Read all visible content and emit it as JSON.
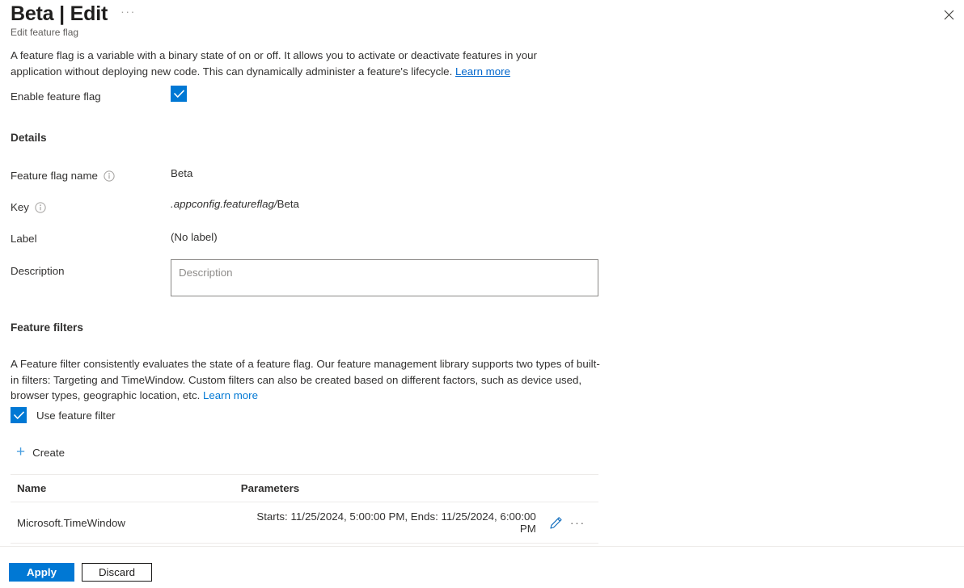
{
  "header": {
    "title": "Beta | Edit",
    "ellipsis": "···",
    "subtitle": "Edit feature flag",
    "close_icon": "close-icon"
  },
  "intro": {
    "text": "A feature flag is a variable with a binary state of on or off. It allows you to activate or deactivate features in your application without deploying new code. This can dynamically administer a feature's lifecycle. ",
    "link_label": "Learn more"
  },
  "enable": {
    "label": "Enable feature flag",
    "checked": true
  },
  "details": {
    "heading": "Details",
    "fields": [
      {
        "label": "Feature flag name",
        "has_info": true,
        "value": "Beta"
      },
      {
        "label": "Key",
        "has_info": true,
        "value_prefix": ".appconfig.featureflag/",
        "value_suffix": "Beta"
      },
      {
        "label": "Label",
        "has_info": false,
        "value": "(No label)"
      }
    ],
    "description": {
      "label": "Description",
      "value": "",
      "placeholder": "Description"
    }
  },
  "feature_filters": {
    "heading": "Feature filters",
    "intro_text": "A Feature filter consistently evaluates the state of a feature flag. Our feature management library supports two types of built-in filters: Targeting and TimeWindow. Custom filters can also be created based on different factors, such as device used, browser types, geographic location, etc. ",
    "intro_link_label": "Learn more",
    "use_filter": {
      "label": "Use feature filter",
      "checked": true
    },
    "create_label": "Create",
    "create_icon": "plus-icon",
    "table": {
      "columns": [
        "Name",
        "Parameters"
      ],
      "rows": [
        {
          "name": "Microsoft.TimeWindow",
          "parameters": "Starts: 11/25/2024, 5:00:00 PM, Ends: 11/25/2024, 6:00:00 PM",
          "edit_icon": "pencil-icon",
          "more_icon": "ellipsis-icon",
          "more_glyph": "···"
        }
      ]
    }
  },
  "footer": {
    "apply_label": "Apply",
    "discard_label": "Discard"
  },
  "colors": {
    "accent": "#0078d4",
    "link": "#0066cc",
    "link_plain": "#0078d4",
    "text": "#323130",
    "border": "#edebe9"
  }
}
